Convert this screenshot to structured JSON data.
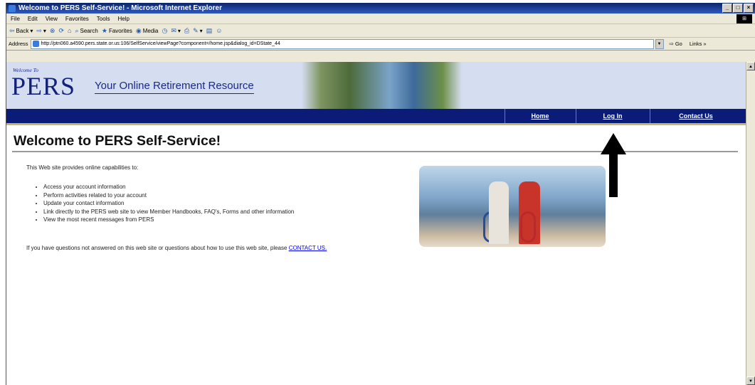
{
  "window": {
    "title": "Welcome to PERS Self-Service! - Microsoft Internet Explorer",
    "buttons": [
      "_",
      "□",
      "×"
    ]
  },
  "menubar": {
    "items": [
      "File",
      "Edit",
      "View",
      "Favorites",
      "Tools",
      "Help"
    ]
  },
  "toolbar": {
    "back": "Back",
    "search": "Search",
    "favorites": "Favorites",
    "media": "Media"
  },
  "addressbar": {
    "label": "Address",
    "url": "http://ptn060.a4590.pers.state.or.us:106/SelfService/viewPage?component=/home.jsp&dialog_id=DState_44",
    "go": "Go",
    "links": "Links"
  },
  "banner": {
    "welcome_to": "Welcome To",
    "logo": "PERS",
    "tagline": "Your Online Retirement Resource"
  },
  "nav": {
    "home": "Home",
    "login": "Log In",
    "contact": "Contact Us"
  },
  "content": {
    "heading": "Welcome to PERS Self-Service!",
    "intro": "This Web site provides online capabilities to:",
    "bullets": [
      "Access your account information",
      "Perform activities related to your account",
      "Update your contact information",
      "Link directly to the PERS web site to view Member Handbooks, FAQ's, Forms and other information",
      "View the most recent messages from PERS"
    ],
    "footnote": "If you have questions not answered on this web site or questions about how to use this web site, please",
    "contact_link": "CONTACT US."
  },
  "colors": {
    "nav_bg": "#0b1b78",
    "banner_bg": "#d5ddf1",
    "logo": "#12217a",
    "link": "#0000ee"
  }
}
